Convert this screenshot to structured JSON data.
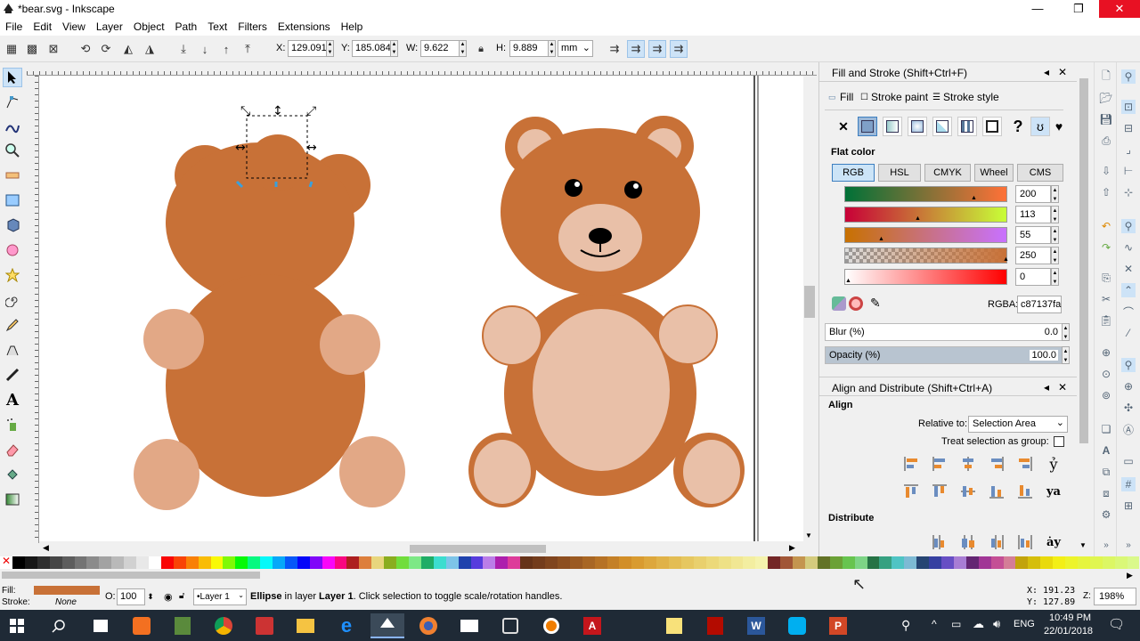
{
  "window": {
    "title": "*bear.svg - Inkscape",
    "min": "—",
    "max": "❐",
    "close": "✕"
  },
  "menu": [
    "File",
    "Edit",
    "View",
    "Layer",
    "Object",
    "Path",
    "Text",
    "Filters",
    "Extensions",
    "Help"
  ],
  "toolbar": {
    "x_label": "X:",
    "x_value": "129.091",
    "y_label": "Y:",
    "y_value": "185.084",
    "w_label": "W:",
    "w_value": "9.622",
    "h_label": "H:",
    "h_value": "9.889",
    "unit": "mm"
  },
  "fill_stroke": {
    "title": "Fill and Stroke (Shift+Ctrl+F)",
    "tabs": [
      "Fill",
      "Stroke paint",
      "Stroke style"
    ],
    "flat_color_label": "Flat color",
    "modes": [
      "RGB",
      "HSL",
      "CMYK",
      "Wheel",
      "CMS"
    ],
    "channels": [
      "200",
      "113",
      "55",
      "250",
      "0"
    ],
    "rgba_label": "RGBA:",
    "rgba_value": "c87137fa",
    "blur_label": "Blur (%)",
    "blur_value": "0.0",
    "opacity_label": "Opacity (%)",
    "opacity_value": "100.0"
  },
  "align": {
    "title": "Align and Distribute (Shift+Ctrl+A)",
    "align_heading": "Align",
    "relative_label": "Relative to:",
    "relative_value": "Selection Area",
    "treat_label": "Treat selection as group:",
    "distribute_heading": "Distribute"
  },
  "status": {
    "fill_label": "Fill:",
    "stroke_label": "Stroke:",
    "stroke_value": "None",
    "opacity_label": "O:",
    "opacity_value": "100",
    "layer": "•Layer 1",
    "msg_bold": "Ellipse",
    "msg_rest": " in layer ",
    "msg_layer": "Layer 1",
    "msg_tail": ". Click selection to toggle scale/rotation handles.",
    "x_coord": "X:  191.23",
    "y_coord": "Y:  127.89",
    "zoom_label": "Z:",
    "zoom_value": "198%"
  },
  "taskbar": {
    "lang": "ENG",
    "time": "10:49 PM",
    "date": "22/01/2018"
  },
  "colors": {
    "bear_fill": "#c87137",
    "light": "#e9c0a8",
    "paw": "#e2a886"
  }
}
